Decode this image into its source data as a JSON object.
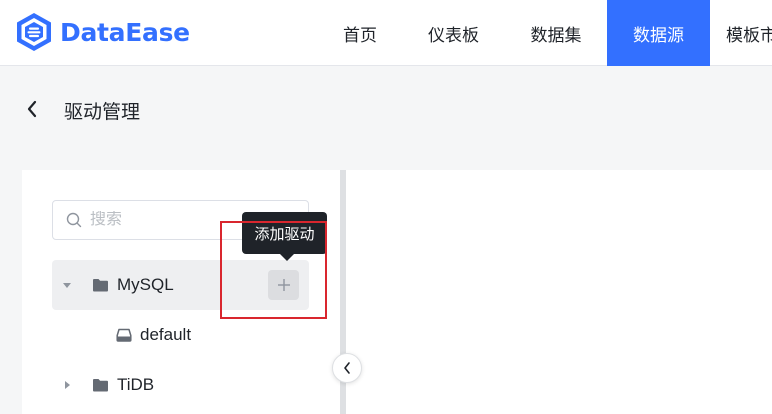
{
  "app": {
    "brand": "DataEase"
  },
  "nav": {
    "items": [
      {
        "label": "首页"
      },
      {
        "label": "仪表板"
      },
      {
        "label": "数据集"
      },
      {
        "label": "数据源",
        "active": true
      },
      {
        "label": "模板市"
      }
    ]
  },
  "page": {
    "title": "驱动管理"
  },
  "search": {
    "placeholder": "搜索",
    "value": ""
  },
  "tree": {
    "nodes": [
      {
        "label": "MySQL",
        "expanded": true,
        "children": [
          {
            "label": "default"
          }
        ]
      },
      {
        "label": "TiDB",
        "expanded": false
      }
    ]
  },
  "tooltip": {
    "text": "添加驱动"
  },
  "colors": {
    "accent": "#3370ff",
    "highlight": "#d9262e",
    "tooltip_bg": "#1f2329",
    "selected_row": "#eeeff1"
  }
}
